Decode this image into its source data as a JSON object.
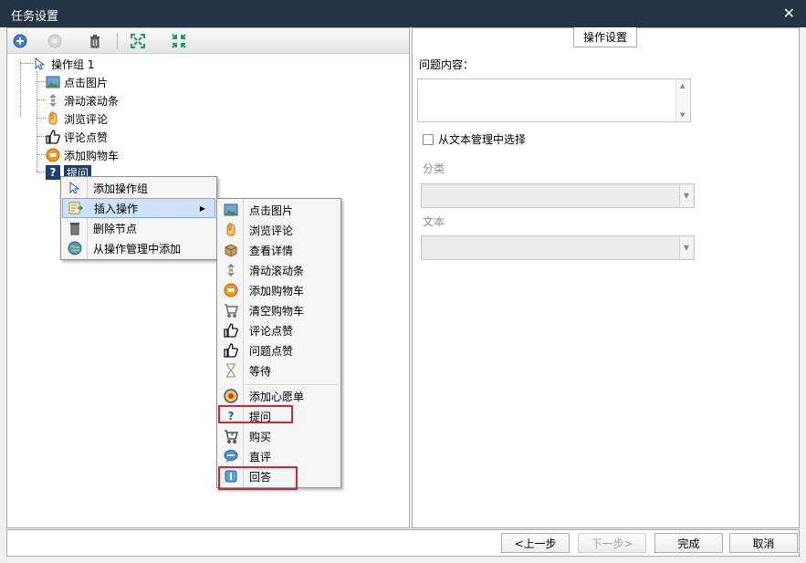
{
  "window": {
    "title": "任务设置",
    "close_glyph": "✕"
  },
  "toolbar": {
    "icons": [
      "add-circle-icon",
      "disabled-circle-icon",
      "trash-icon",
      "expand-all-icon",
      "collapse-all-icon"
    ]
  },
  "tree": {
    "root": "操作组 1",
    "children": [
      "点击图片",
      "滑动滚动条",
      "浏览评论",
      "评论点赞",
      "添加购物车",
      "提问"
    ]
  },
  "context_menu": {
    "items": [
      "添加操作组",
      "插入操作",
      "删除节点",
      "从操作管理中添加"
    ],
    "submenu_arrow": "▶"
  },
  "submenu": {
    "items": [
      "点击图片",
      "浏览评论",
      "查看详情",
      "滑动滚动条",
      "添加购物车",
      "清空购物车",
      "评论点赞",
      "问题点赞",
      "等待",
      "添加心愿单",
      "提问",
      "购买",
      "直评",
      "回答"
    ]
  },
  "panel": {
    "tab": "操作设置",
    "question_label": "问题内容：",
    "checkbox_label": "从文本管理中选择",
    "category_label": "分类",
    "text_label": "文本",
    "scroll_up": "▲",
    "scroll_down": "▼",
    "combo_arrow": "▼"
  },
  "buttons": {
    "prev": "<上一步",
    "next": "下一步>",
    "finish": "完成",
    "cancel": "取消"
  },
  "colors": {
    "titlebar": "#243447",
    "selection": "#1f3f6b",
    "highlight_border": "#d9262c",
    "menu_highlight": "#cfe2f5"
  }
}
